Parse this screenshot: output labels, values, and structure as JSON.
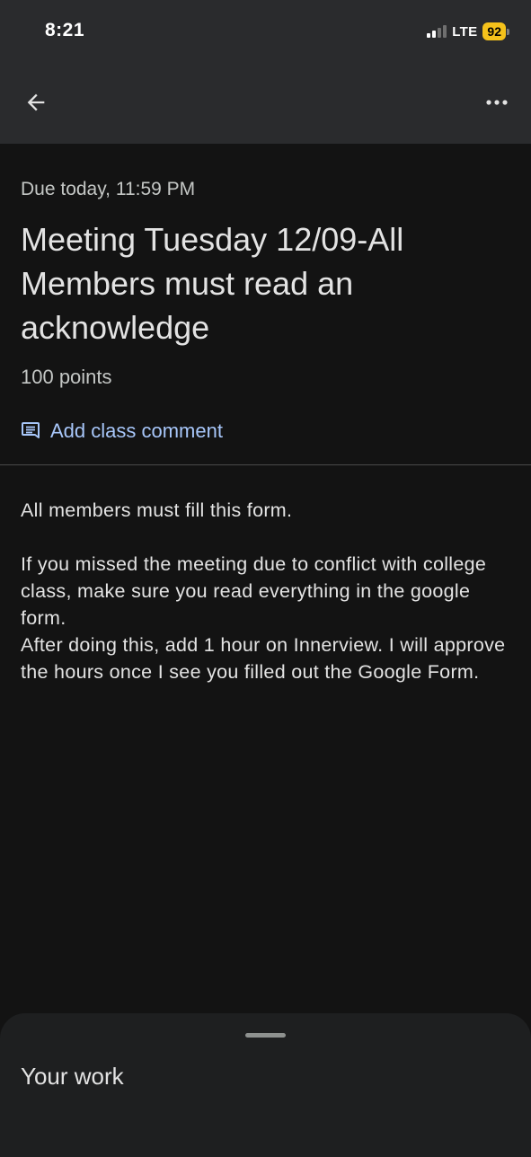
{
  "status_bar": {
    "time": "8:21",
    "network": "LTE",
    "battery": "92"
  },
  "toolbar": {
    "back_icon": "arrow-left-icon",
    "more_icon": "more-horizontal-icon"
  },
  "assignment": {
    "due": "Due today, 11:59 PM",
    "title": "Meeting Tuesday 12/09-All Members must read an acknowledge",
    "points": "100 points",
    "comment_label": "Add class comment",
    "comment_icon": "comment-icon",
    "description": "All members must fill this form.\n\nIf you missed the meeting due to conflict with college class, make sure you read everything in the google form.\nAfter doing this, add 1 hour on Innerview. I will approve the hours once I see you filled out the Google Form."
  },
  "bottom_sheet": {
    "title": "Your work"
  },
  "colors": {
    "background": "#131313",
    "top_bar": "#2a2b2d",
    "link": "#a8c7fa",
    "battery": "#f5c21b"
  }
}
